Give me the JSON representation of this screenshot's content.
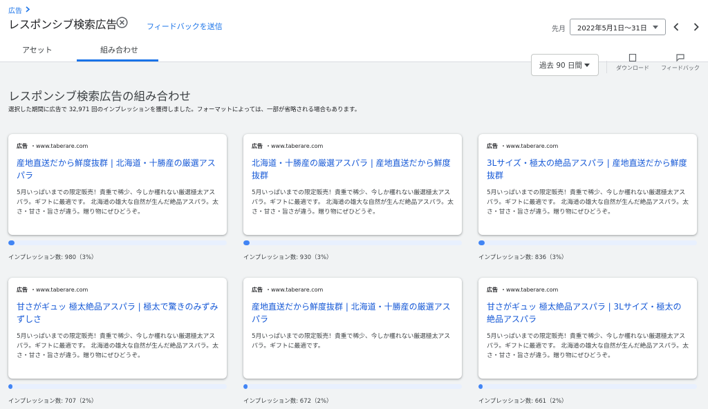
{
  "header": {
    "breadcrumb": "広告",
    "title": "レスポンシブ検索広告",
    "feedback_link": "フィードバックを送信",
    "period_label": "先月",
    "date_range": "2022年5月1日～31日"
  },
  "tabs": [
    {
      "label": "アセット",
      "selected": false
    },
    {
      "label": "組み合わせ",
      "selected": true
    }
  ],
  "toolbar": {
    "range": "過去 90 日間",
    "download": "ダウンロード",
    "feedback": "フィードバック"
  },
  "section": {
    "title": "レスポンシブ検索広告の組み合わせ",
    "subtitle": "選択した期間に広告で 32,971 回のインプレッションを獲得しました。フォーマットによっては、一部が省略される場合もあります。"
  },
  "cards": [
    {
      "badge": "広告",
      "url": "・www.taberare.com",
      "headline": "産地直送だから鮮度抜群 | 北海道・十勝産の厳選アスパラ",
      "description": "5月いっぱいまでの限定販売！貴重で稀少、今しか穫れない厳選極太アスパラ。ギフトに最適です。 北海道の雄大な自然が生んだ絶品アスパラ。太さ・甘さ・旨さが違う。贈り物にぜひどうぞ。",
      "impressions_label": "インプレッション数: 980（3%）",
      "share": 0.03
    },
    {
      "badge": "広告",
      "url": "・www.taberare.com",
      "headline": "北海道・十勝産の厳選アスパラ | 産地直送だから鮮度抜群",
      "description": "5月いっぱいまでの限定販売！貴重で稀少、今しか穫れない厳選極太アスパラ。ギフトに最適です。 北海道の雄大な自然が生んだ絶品アスパラ。太さ・甘さ・旨さが違う。贈り物にぜひどうぞ。",
      "impressions_label": "インプレッション数: 930（3%）",
      "share": 0.03
    },
    {
      "badge": "広告",
      "url": "・www.taberare.com",
      "headline": "3Lサイズ・極太の絶品アスパラ | 産地直送だから鮮度抜群",
      "description": "5月いっぱいまでの限定販売！貴重で稀少、今しか穫れない厳選極太アスパラ。ギフトに最適です。 北海道の雄大な自然が生んだ絶品アスパラ。太さ・甘さ・旨さが違う。贈り物にぜひどうぞ。",
      "impressions_label": "インプレッション数: 836（3%）",
      "share": 0.03
    },
    {
      "badge": "広告",
      "url": "・www.taberare.com",
      "headline": "甘さがギュッ 極太絶品アスパラ | 極太で驚きのみずみずしさ",
      "description": "5月いっぱいまでの限定販売！貴重で稀少、今しか穫れない厳選極太アスパラ。ギフトに最適です。 北海道の雄大な自然が生んだ絶品アスパラ。太さ・甘さ・旨さが違う。贈り物にぜひどうぞ。",
      "impressions_label": "インプレッション数: 707（2%）",
      "share": 0.02
    },
    {
      "badge": "広告",
      "url": "・www.taberare.com",
      "headline": "産地直送だから鮮度抜群 | 北海道・十勝産の厳選アスパラ",
      "description": "5月いっぱいまでの限定販売！貴重で稀少、今しか穫れない厳選極太アスパラ。ギフトに最適です。",
      "impressions_label": "インプレッション数: 672（2%）",
      "share": 0.02
    },
    {
      "badge": "広告",
      "url": "・www.taberare.com",
      "headline": "甘さがギュッ 極太絶品アスパラ | 3Lサイズ・極太の絶品アスパラ",
      "description": "5月いっぱいまでの限定販売！貴重で稀少、今しか穫れない厳選極太アスパラ。ギフトに最適です。 北海道の雄大な自然が生んだ絶品アスパラ。太さ・甘さ・旨さが違う。贈り物にぜひどうぞ。",
      "impressions_label": "インプレッション数: 661（2%）",
      "share": 0.02
    }
  ],
  "icons": {
    "breadcrumb_chevron": "chevron-right-icon",
    "close": "close-circle-icon",
    "date_caret": "caret-down-icon",
    "prev": "chevron-left-icon",
    "next": "chevron-right-icon",
    "download": "download-icon",
    "feedback": "feedback-icon"
  },
  "colors": {
    "accent": "#1a73e8",
    "link": "#1558d6",
    "bar_fill": "#4285f4",
    "bar_track": "#e8f0fe"
  }
}
